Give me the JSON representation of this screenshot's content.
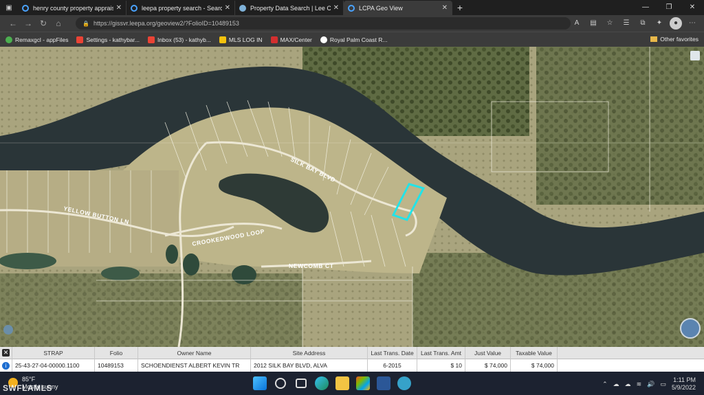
{
  "browser": {
    "tabs": [
      {
        "label": "henry county property appraiser",
        "icon": "search-icon",
        "active": false
      },
      {
        "label": "leepa property search - Search",
        "icon": "search-icon",
        "active": false
      },
      {
        "label": "Property Data Search | Lee Coun",
        "icon": "globe-icon",
        "active": false
      },
      {
        "label": "LCPA Geo View",
        "icon": "search-icon",
        "active": true
      }
    ],
    "new_tab_glyph": "+",
    "url": "https://gissvr.leepa.org/geoview2/?FolioID=10489153",
    "bookmarks": [
      {
        "label": "Remaxgcl - appFiles",
        "icon": "cloud-icon",
        "color": "#4caf50"
      },
      {
        "label": "Settings - kathybar...",
        "icon": "gmail-icon",
        "color": "#ea4335"
      },
      {
        "label": "Inbox (53) - kathyb...",
        "icon": "gmail-icon",
        "color": "#ea4335"
      },
      {
        "label": "MLS LOG IN",
        "icon": "mls-icon",
        "color": "#f4c20d"
      },
      {
        "label": "MAX/Center",
        "icon": "remax-icon",
        "color": "#d32f2f"
      },
      {
        "label": "Royal Palm Coast R...",
        "icon": "royal-palm-icon",
        "color": "#ffffff"
      }
    ],
    "other_favorites": "Other favorites"
  },
  "map": {
    "street_labels": [
      "SILK BAY BLVD",
      "YELLOW BUTTON LN",
      "CROOKEDWOOD LOOP",
      "NEWCOMB CT"
    ],
    "highlight_color": "#22e3e8"
  },
  "results": {
    "columns": [
      "STRAP",
      "Folio",
      "Owner Name",
      "Site Address",
      "Last Trans. Date",
      "Last Trans. Amt",
      "Just Value",
      "Taxable Value"
    ],
    "rows": [
      [
        "25-43-27-04-00000.1100",
        "10489153",
        "SCHOENDIENST ALBERT KEVIN TR",
        "2012 SILK BAY BLVD, ALVA",
        "6-2015",
        "$ 10",
        "$ 74,000",
        "$ 74,000"
      ]
    ]
  },
  "taskbar": {
    "temperature": "85°F",
    "weather": "Mostly sunny",
    "watermark": "SWFLAMLS",
    "time": "1:11 PM",
    "date": "5/9/2022"
  }
}
